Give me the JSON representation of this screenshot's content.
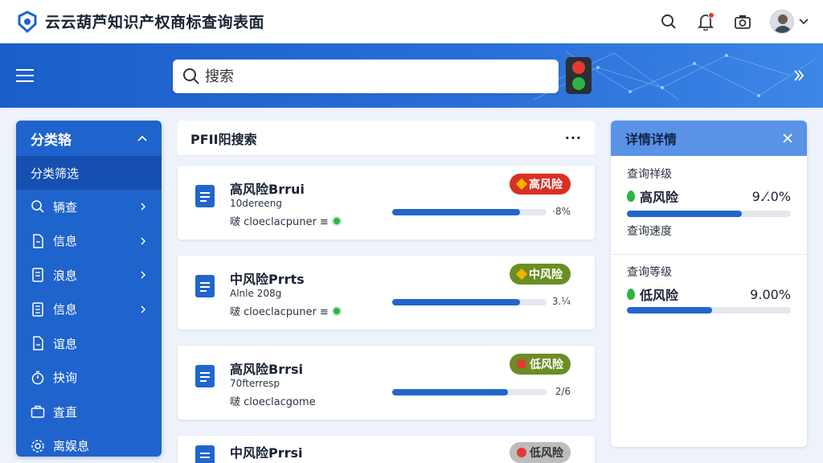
{
  "app": {
    "title": "云云葫芦知识产权商标查询表面"
  },
  "header": {
    "search_placeholder": "搜索"
  },
  "sidebar": {
    "title": "分类辂",
    "active": "分类筛选",
    "items": [
      {
        "label": "辆查",
        "icon": "search-icon"
      },
      {
        "label": "信息",
        "icon": "file-icon"
      },
      {
        "label": "浪息",
        "icon": "document-icon"
      },
      {
        "label": "信息",
        "icon": "document-lines-icon"
      },
      {
        "label": "谊息",
        "icon": "page-icon"
      },
      {
        "label": "抉询",
        "icon": "timer-icon"
      },
      {
        "label": "査直",
        "icon": "briefcase-icon"
      },
      {
        "label": "离娱息",
        "icon": "gear-icon"
      }
    ]
  },
  "results": {
    "title": "PFII阳搜索",
    "cards": [
      {
        "title": "高风险Brrui",
        "line2": "10dereeng",
        "line3": "啵 cloeclacpuner ≡",
        "badge": "高风险",
        "badge_color": "#d93025",
        "marker_color": "#f4b400",
        "marker": "diamond",
        "progress": 0.83,
        "pct": "·8%",
        "status_ok": true
      },
      {
        "title": "中风险Prrts",
        "line2": "Alnle 208g",
        "line3": "啵 cloeclacpuner ≡",
        "badge": "中风险",
        "badge_color": "#6b8e23",
        "marker_color": "#f4b400",
        "marker": "diamond",
        "progress": 0.83,
        "pct": "3.¼",
        "status_ok": true
      },
      {
        "title": "高风险Brrsi",
        "line2": "70fterresp",
        "line3": "啵 cloeclacgome",
        "badge": "低风险",
        "badge_color": "#6b8e23",
        "marker_color": "#e53935",
        "marker": "circle",
        "progress": 0.75,
        "pct": "2/6",
        "status_ok": false
      },
      {
        "title": "中风险Prrsi",
        "line2": "",
        "line3": "",
        "badge": "低风险",
        "badge_color": "#bdbdbd",
        "marker_color": "#e53935",
        "marker": "circle",
        "progress": 0,
        "pct": "",
        "status_ok": false
      }
    ]
  },
  "detail": {
    "title": "详情详情",
    "section1_label": "查询祥级",
    "row1": {
      "label": "高风险",
      "value": "9.⁄.0%",
      "progress": 0.7
    },
    "section2_label": "查询速度",
    "section3_label": "查询等级",
    "row2": {
      "label": "低风险",
      "value": "9.00%",
      "progress": 0.52
    }
  },
  "colors": {
    "primary": "#1f63cc",
    "band": "#2a6fd9",
    "accent_green": "#2fb344",
    "danger": "#d93025"
  }
}
